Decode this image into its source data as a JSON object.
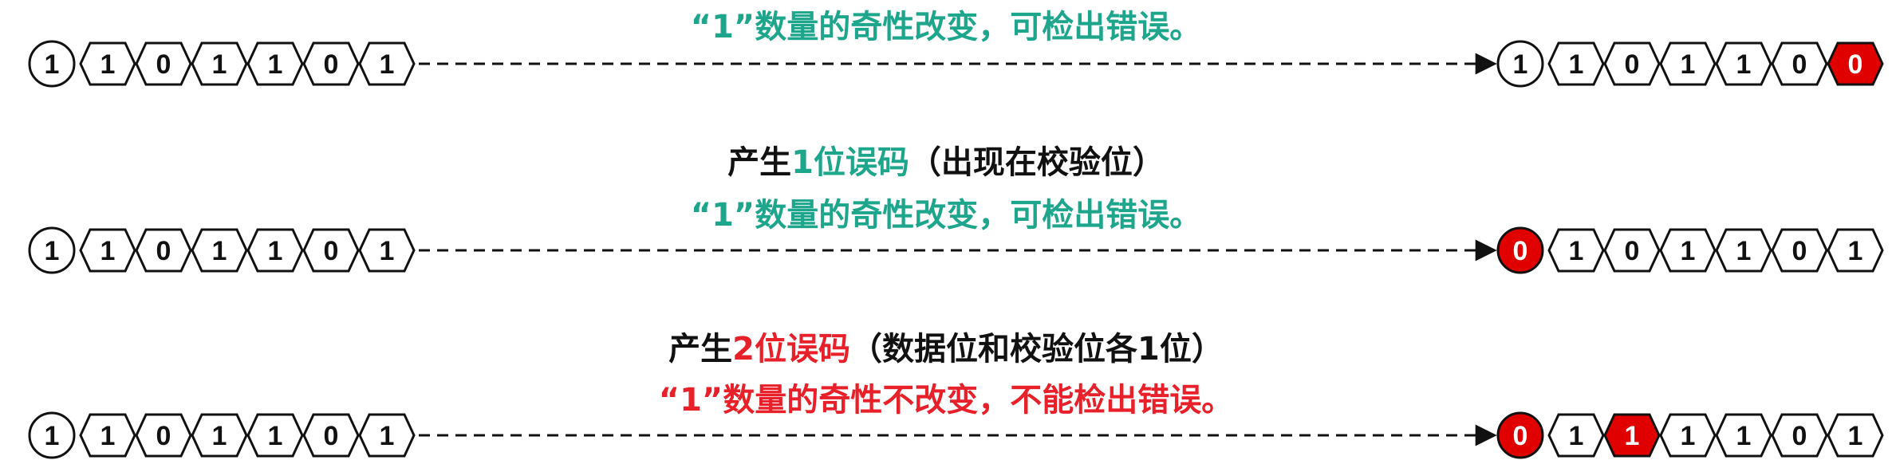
{
  "colors": {
    "teal": "#1ea68c",
    "red": "#e8202a",
    "black": "#111111",
    "error_fill": "#e00000"
  },
  "rows": [
    {
      "heading": null,
      "status": "“1”数量的奇性改变，可检出错误。",
      "status_color": "teal",
      "sent_bits": [
        "1",
        "1",
        "0",
        "1",
        "1",
        "0",
        "1"
      ],
      "received_bits": [
        "1",
        "1",
        "0",
        "1",
        "1",
        "0",
        "0"
      ],
      "error_positions": [
        6
      ]
    },
    {
      "heading": {
        "prefix": "产生",
        "highlight": "1位误码",
        "suffix": "（出现在校验位）",
        "highlight_color": "teal"
      },
      "status": "“1”数量的奇性改变，可检出错误。",
      "status_color": "teal",
      "sent_bits": [
        "1",
        "1",
        "0",
        "1",
        "1",
        "0",
        "1"
      ],
      "received_bits": [
        "0",
        "1",
        "0",
        "1",
        "1",
        "0",
        "1"
      ],
      "error_positions": [
        0
      ]
    },
    {
      "heading": {
        "prefix": "产生",
        "highlight": "2位误码",
        "suffix": "（数据位和校验位各1位）",
        "highlight_color": "red"
      },
      "status": "“1”数量的奇性不改变，不能检出错误。",
      "status_color": "red",
      "sent_bits": [
        "1",
        "1",
        "0",
        "1",
        "1",
        "0",
        "1"
      ],
      "received_bits": [
        "0",
        "1",
        "1",
        "1",
        "1",
        "0",
        "1"
      ],
      "error_positions": [
        0,
        2
      ]
    }
  ]
}
